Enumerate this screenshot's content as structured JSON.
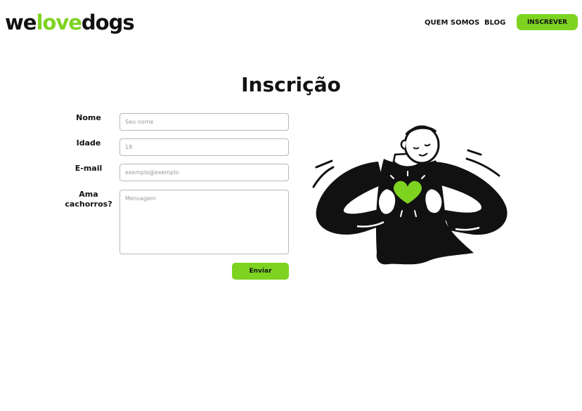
{
  "header": {
    "logo": {
      "part1": "we",
      "part2": "love",
      "part3": "dogs"
    },
    "nav": {
      "about": "QUEM SOMOS",
      "blog": "BLOG"
    },
    "subscribe_button": "INSCREVER"
  },
  "main": {
    "title": "Inscrição",
    "form": {
      "name": {
        "label": "Nome",
        "placeholder": "Seu nome",
        "value": ""
      },
      "age": {
        "label": "Idade",
        "placeholder": "18",
        "value": ""
      },
      "email": {
        "label": "E-mail",
        "placeholder": "exemplo@exemplo",
        "value": ""
      },
      "loves_dogs": {
        "label_line1": "Ama",
        "label_line2": "cachorros?",
        "placeholder": "Mensagem",
        "value": ""
      },
      "submit_label": "Enviar"
    }
  },
  "colors": {
    "accent": "#7ed321",
    "text": "#111111",
    "border": "#b8b8b8",
    "placeholder": "#9a9a9a"
  },
  "illustration": {
    "name": "person-holding-heart-illustration"
  }
}
